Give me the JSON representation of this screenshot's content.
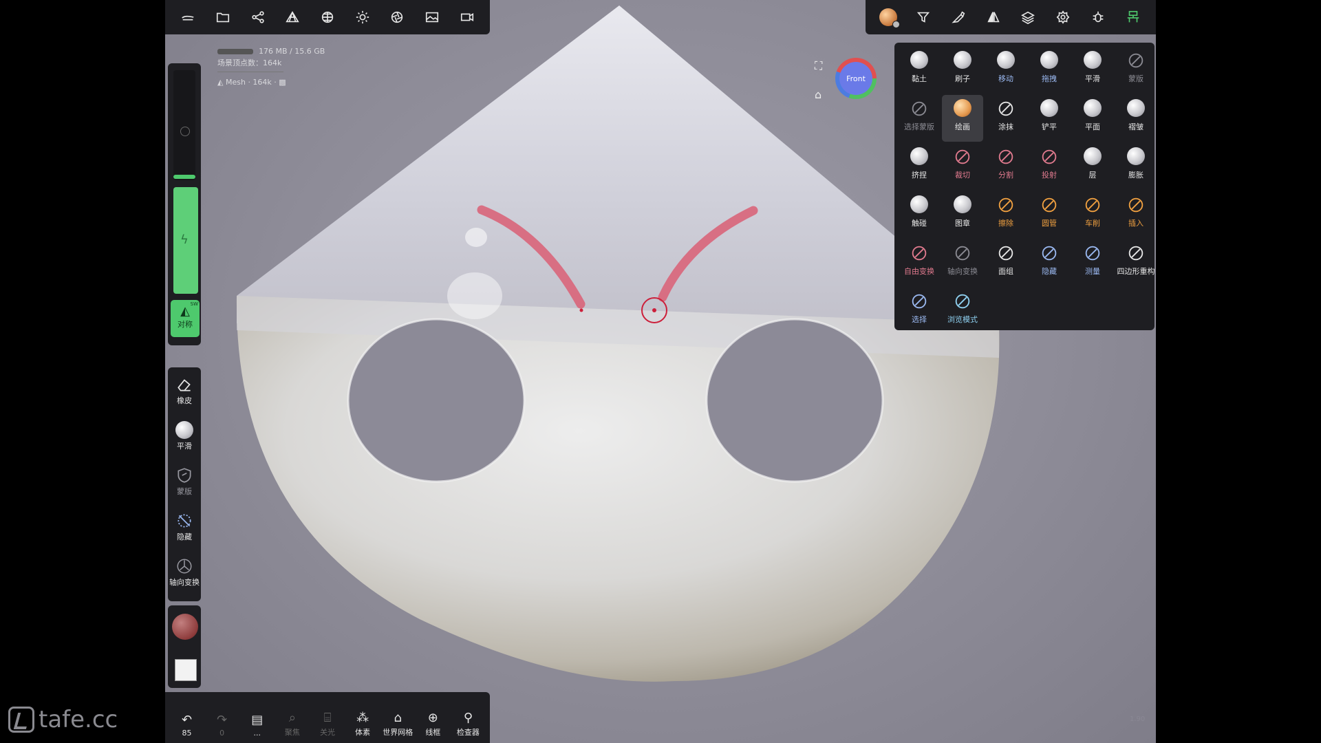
{
  "colors": {
    "accent_green": "#4ec96d",
    "paint_stroke": "#d9657a",
    "cursor": "#cc1f3a",
    "panel_bg": "#1e1e22"
  },
  "top_toolbar": {
    "icons": [
      "hamburger-cloud-icon",
      "folder-icon",
      "share-icon",
      "mesh-icon",
      "sphere-grid-icon",
      "sun-icon",
      "aperture-icon",
      "image-icon",
      "video-icon"
    ]
  },
  "top_right_toolbar": {
    "icons": [
      "material-ball-icon",
      "filter-icon",
      "brush-pen-icon",
      "symmetry-icon",
      "layers-icon",
      "settings-icon",
      "bug-icon",
      "scene-tree-icon"
    ]
  },
  "info": {
    "memory": "176 MB / 15.6 GB",
    "vertices": "场景顶点数：164k",
    "mesh_label": "Mesh",
    "mesh_count": "· 164k ·"
  },
  "left_sidebar": {
    "symmetry_label": "对称",
    "symmetry_badge": "SW",
    "tools": [
      {
        "label": "橡皮",
        "icon": "eraser-icon"
      },
      {
        "label": "平滑",
        "icon": "smooth-ball-icon"
      },
      {
        "label": "蒙版",
        "icon": "mask-shield-icon"
      },
      {
        "label": "隐藏",
        "icon": "hide-icon"
      },
      {
        "label": "轴向变换",
        "icon": "gizmo-icon"
      }
    ]
  },
  "bottom_toolbar": {
    "undo_count": "85",
    "items": [
      {
        "label": "85",
        "icon": "undo-icon"
      },
      {
        "label": "0",
        "icon": "redo-icon"
      },
      {
        "label": "...",
        "icon": "panel-icon"
      },
      {
        "label": "聚焦",
        "icon": "focus-icon"
      },
      {
        "label": "关光",
        "icon": "lights-icon"
      },
      {
        "label": "体素",
        "icon": "voxel-icon"
      },
      {
        "label": "世界网格",
        "icon": "world-grid-icon"
      },
      {
        "label": "线框",
        "icon": "wireframe-icon"
      },
      {
        "label": "检查器",
        "icon": "inspector-icon"
      }
    ]
  },
  "tool_grid": [
    {
      "label": "黏土",
      "icon": "clay-icon",
      "style": "ball"
    },
    {
      "label": "刷子",
      "icon": "brush-icon",
      "style": "ball"
    },
    {
      "label": "移动",
      "icon": "move-icon",
      "style": "ball-blue"
    },
    {
      "label": "拖拽",
      "icon": "drag-icon",
      "style": "ball-blue"
    },
    {
      "label": "平滑",
      "icon": "smooth-icon",
      "style": "ball"
    },
    {
      "label": "蒙版",
      "icon": "mask-icon",
      "style": "dim"
    },
    {
      "label": "选择蒙版",
      "icon": "select-mask-icon",
      "style": "dim"
    },
    {
      "label": "绘画",
      "icon": "paint-icon",
      "style": "active"
    },
    {
      "label": "涂抹",
      "icon": "smudge-icon",
      "style": "normal"
    },
    {
      "label": "铲平",
      "icon": "flatten-icon",
      "style": "ball"
    },
    {
      "label": "平面",
      "icon": "planar-icon",
      "style": "ball"
    },
    {
      "label": "褶皱",
      "icon": "crease-icon",
      "style": "ball"
    },
    {
      "label": "挤捏",
      "icon": "pinch-icon",
      "style": "ball"
    },
    {
      "label": "裁切",
      "icon": "trim-icon",
      "style": "red"
    },
    {
      "label": "分割",
      "icon": "split-icon",
      "style": "red"
    },
    {
      "label": "投射",
      "icon": "project-icon",
      "style": "red"
    },
    {
      "label": "层",
      "icon": "layer-icon",
      "style": "ball"
    },
    {
      "label": "膨胀",
      "icon": "inflate-icon",
      "style": "ball"
    },
    {
      "label": "触碰",
      "icon": "tube-icon",
      "style": "ball"
    },
    {
      "label": "图章",
      "icon": "stamp-icon",
      "style": "ball"
    },
    {
      "label": "擦除",
      "icon": "delete-icon",
      "style": "orange"
    },
    {
      "label": "圆管",
      "icon": "curve-tube-icon",
      "style": "orange"
    },
    {
      "label": "车削",
      "icon": "lathe-icon",
      "style": "orange"
    },
    {
      "label": "插入",
      "icon": "insert-icon",
      "style": "orange"
    },
    {
      "label": "自由变换",
      "icon": "free-transform-icon",
      "style": "red"
    },
    {
      "label": "轴向变换",
      "icon": "axis-transform-icon",
      "style": "dim"
    },
    {
      "label": "面组",
      "icon": "facegroup-icon",
      "style": "normal"
    },
    {
      "label": "隐藏",
      "icon": "hide-tool-icon",
      "style": "blue"
    },
    {
      "label": "测量",
      "icon": "measure-icon",
      "style": "blue"
    },
    {
      "label": "四边形重构",
      "icon": "quad-remesh-icon",
      "style": "normal"
    },
    {
      "label": "选择",
      "icon": "select-icon",
      "style": "blue"
    },
    {
      "label": "浏览模式",
      "icon": "camera-view-icon",
      "style": "cyan"
    }
  ],
  "gizmo": {
    "label": "Front"
  },
  "fps": "1.90",
  "watermark": "tafe.cc"
}
